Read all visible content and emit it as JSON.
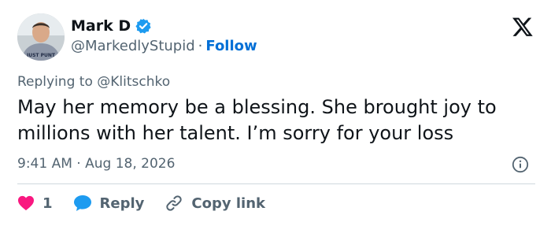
{
  "author": {
    "name": "Mark D",
    "handle": "@MarkedlyStupid",
    "follow_label": "Follow",
    "separator": "·"
  },
  "reply_context": {
    "prefix": "Replying to",
    "mention": "@Klitschko"
  },
  "tweet": {
    "text": "May her memory be a blessing. She brought joy to millions with her talent. I’m sorry for your loss"
  },
  "meta": {
    "time": "9:41 AM",
    "separator": "·",
    "date": "Aug 18, 2026"
  },
  "actions": {
    "like_count": "1",
    "reply_label": "Reply",
    "copy_label": "Copy link"
  },
  "avatar_shirt_text": "JUST PUNT",
  "colors": {
    "accent": "#006fd6",
    "like": "#f91880",
    "reply_bubble": "#1d9bf0",
    "verified": "#1d9bf0",
    "muted": "#536471",
    "divider": "#cfd9de"
  },
  "icons": {
    "verified": "verified-badge-icon",
    "x_logo": "x-logo-icon",
    "info": "info-icon",
    "like": "heart-icon",
    "reply": "speech-bubble-icon",
    "copy": "link-icon"
  }
}
